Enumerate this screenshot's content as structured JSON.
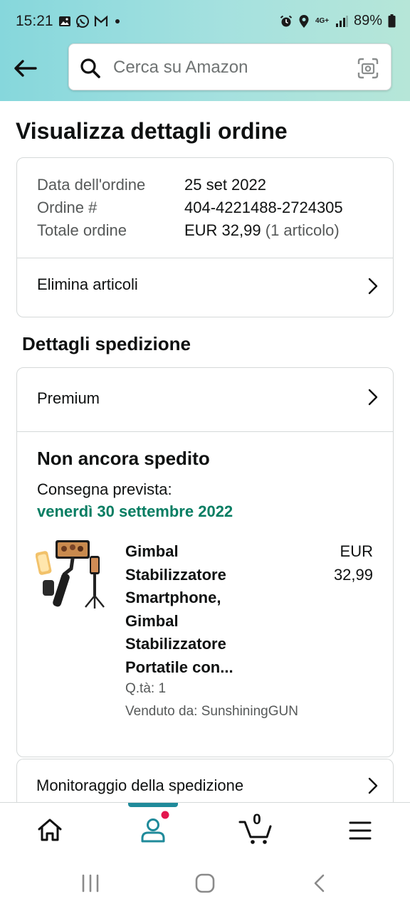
{
  "status_bar": {
    "time": "15:21",
    "network": "4G+",
    "battery": "89%"
  },
  "header": {
    "search_placeholder": "Cerca su Amazon"
  },
  "page_title": "Visualizza dettagli ordine",
  "order_summary": {
    "date_label": "Data dell'ordine",
    "date_value": "25 set 2022",
    "order_label": "Ordine #",
    "order_value": "404-4221488-2724305",
    "total_label": "Totale ordine",
    "total_value": "EUR 32,99",
    "total_items": "(1 articolo)",
    "delete_items_label": "Elimina articoli"
  },
  "shipping": {
    "section_title": "Dettagli spedizione",
    "shipping_method": "Premium",
    "status": "Non ancora spedito",
    "delivery_label": "Consegna prevista:",
    "delivery_date": "venerdì 30 settembre 2022",
    "delivery_date_color": "#067d62",
    "product": {
      "title": "Gimbal Stabilizzatore Smartphone, Gimbal Stabilizzatore Portatile con...",
      "price_currency": "EUR",
      "price_value": "32,99",
      "quantity": "Q.tà: 1",
      "seller": "Venduto da: SunshiningGUN"
    },
    "tracking_label": "Monitoraggio della spedizione"
  },
  "bottom_nav": {
    "items": [
      "home-icon",
      "account-icon",
      "cart-icon",
      "menu-icon"
    ],
    "cart_count": "0",
    "active_color": "#1f8a9a",
    "notification_color": "#e3174f"
  }
}
